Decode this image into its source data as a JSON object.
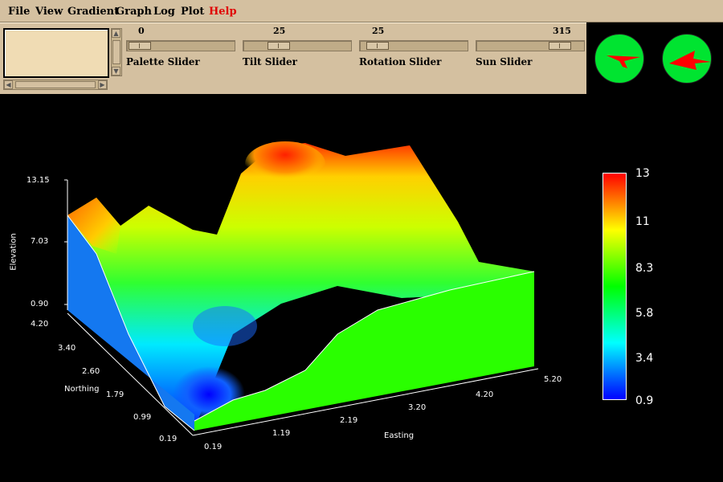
{
  "menu": {
    "file": "File",
    "view": "View",
    "gradient": "Gradient",
    "graph": "Graph",
    "log": "Log",
    "plot": "Plot",
    "help": "Help"
  },
  "sliders": {
    "palette": {
      "label": "Palette Slider",
      "value": "0"
    },
    "tilt": {
      "label": "Tilt Slider",
      "value": "25"
    },
    "rotation": {
      "label": "Rotation Slider",
      "value": "25"
    },
    "sun": {
      "label": "Sun Slider",
      "value": "315"
    }
  },
  "compass": {
    "background_color": "#00e430",
    "arrow_color": "#ff0000"
  },
  "plot": {
    "z_ticks": [
      "13.15",
      "7.03",
      "0.90"
    ],
    "ylabel": "Elevation",
    "northing_label": "Northing",
    "northing_ticks": [
      "4.20",
      "3.40",
      "2.60",
      "1.79",
      "0.99",
      "0.19"
    ],
    "easting_label": "Easting",
    "easting_ticks": [
      "0.19",
      "1.19",
      "2.19",
      "3.20",
      "4.20",
      "5.20"
    ],
    "legend_ticks": [
      "13",
      "11",
      "8.3",
      "5.8",
      "3.4",
      "0.9"
    ],
    "colormap": [
      "#ff0000",
      "#ffff00",
      "#00ff00",
      "#00ffff",
      "#0000ff"
    ]
  }
}
